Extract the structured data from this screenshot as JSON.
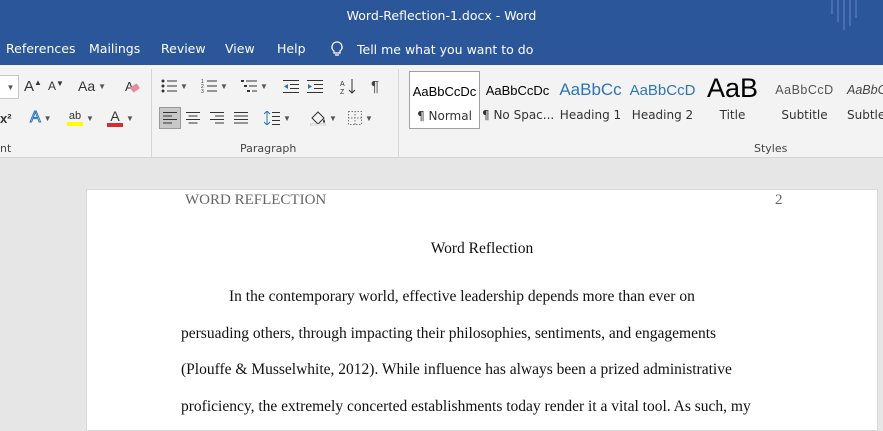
{
  "window": {
    "title": "Word-Reflection-1.docx  -  Word"
  },
  "menu": {
    "items": [
      "References",
      "Mailings",
      "Review",
      "View",
      "Help"
    ],
    "tell_me": "Tell me what you want to do"
  },
  "ribbon": {
    "groups": {
      "font_partial": "nt",
      "paragraph": "Paragraph",
      "styles": "Styles"
    },
    "font_controls": {
      "grow": "A",
      "shrink": "A",
      "change_case": "Aa",
      "superscript": "x²",
      "effects": "A",
      "highlight": "ab",
      "font_color": "A"
    },
    "styles": [
      {
        "sample": "AaBbCcDc",
        "name": "¶ Normal"
      },
      {
        "sample": "AaBbCcDc",
        "name": "¶ No Spac..."
      },
      {
        "sample": "AaBbCc",
        "name": "Heading 1"
      },
      {
        "sample": "AaBbCcD",
        "name": "Heading 2"
      },
      {
        "sample": "AaB",
        "name": "Title"
      },
      {
        "sample": "AaBbCcD",
        "name": "Subtitle"
      },
      {
        "sample": "AaBbC",
        "name": "Subtle"
      }
    ],
    "colors": {
      "highlight": "#ffff00",
      "font_color": "#d32f2f",
      "heading_blue": "#2e74b5"
    }
  },
  "document": {
    "header_left": "WORD REFLECTION",
    "header_right": "2",
    "title": "Word Reflection",
    "lines": [
      "In the contemporary world, effective leadership depends more than ever on",
      "persuading others, through impacting their philosophies, sentiments, and engagements",
      "(Plouffe & Musselwhite, 2012). While influence has always been a prized administrative",
      "proficiency, the extremely concerted establishments today render it a vital tool. As such, my"
    ]
  }
}
